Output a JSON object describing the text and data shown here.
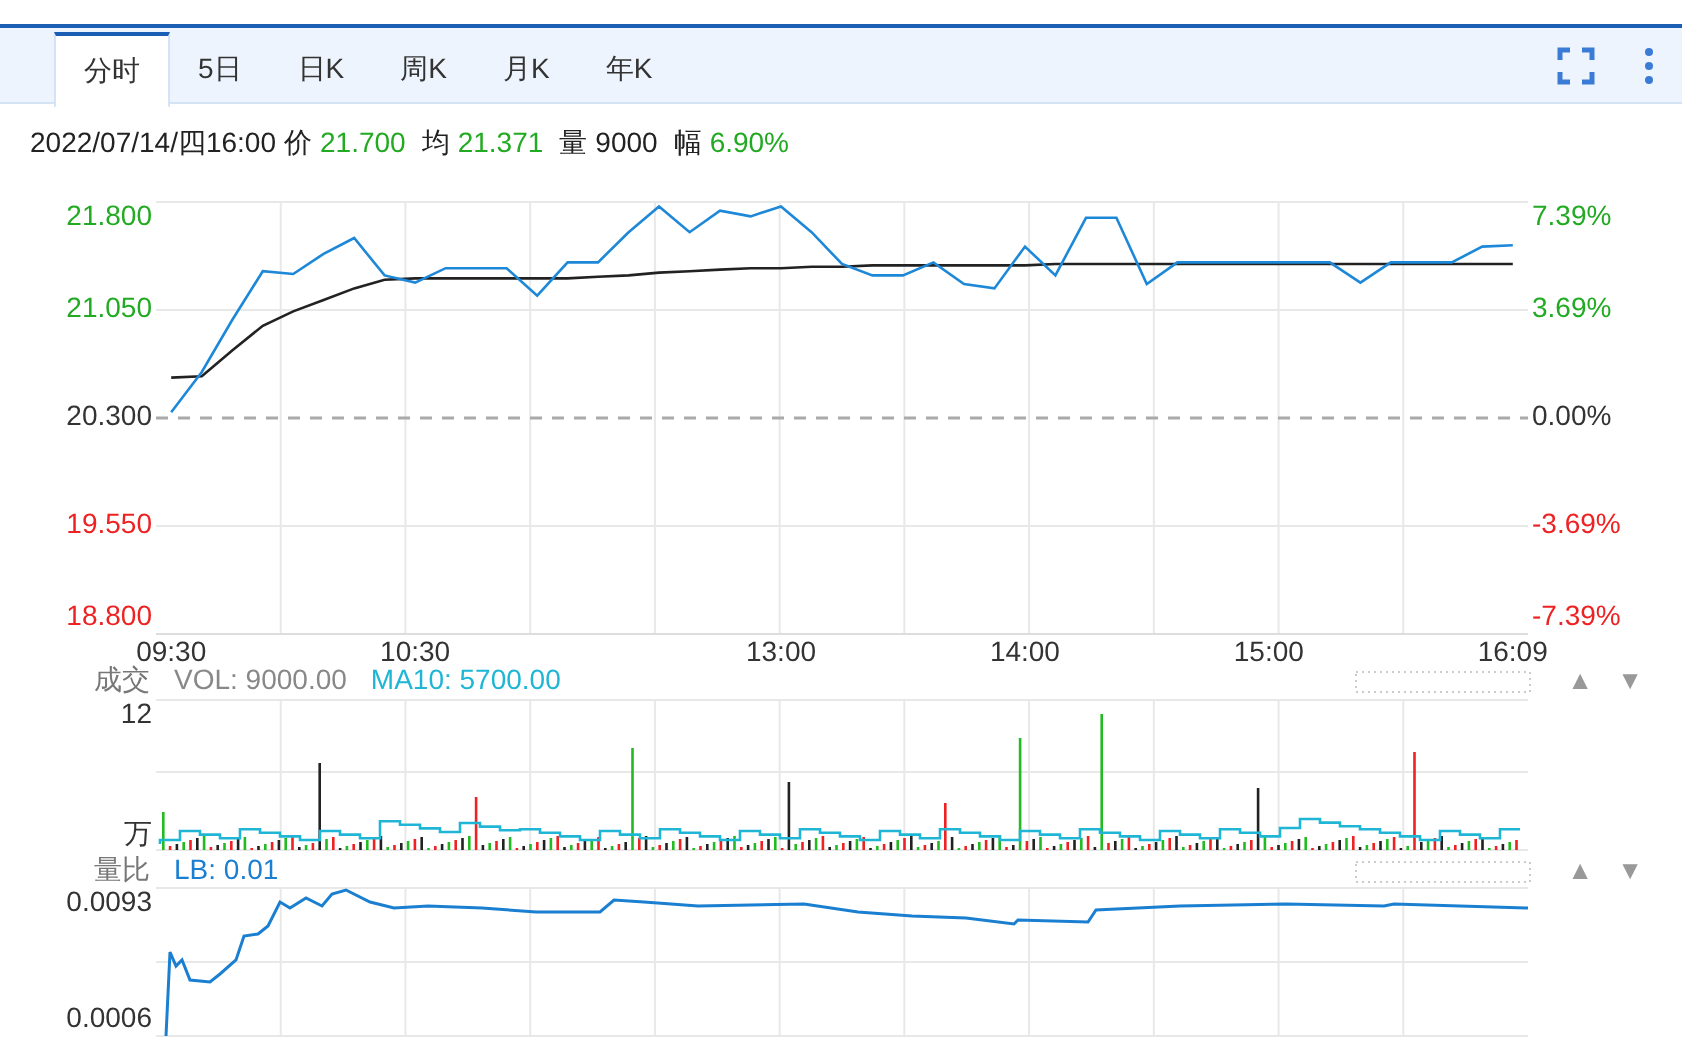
{
  "tabs": [
    {
      "label": "分时",
      "selected": true
    },
    {
      "label": "5日",
      "selected": false
    },
    {
      "label": "日K",
      "selected": false
    },
    {
      "label": "周K",
      "selected": false
    },
    {
      "label": "月K",
      "selected": false
    },
    {
      "label": "年K",
      "selected": false
    }
  ],
  "quote": {
    "datetime": "2022/07/14/四16:00",
    "fields": [
      {
        "label": "价",
        "value": "21.700",
        "color": "#22aa22"
      },
      {
        "label": "均",
        "value": "21.371",
        "color": "#22aa22"
      },
      {
        "label": "量",
        "value": "9000",
        "color": "#222222"
      },
      {
        "label": "幅",
        "value": "6.90%",
        "color": "#22aa22"
      }
    ]
  },
  "price_chart": {
    "chart_data": {
      "type": "line",
      "categories": [
        "09:30",
        null,
        null,
        null,
        null,
        null,
        null,
        null,
        "10:30",
        null,
        null,
        null,
        null,
        null,
        null,
        null,
        null,
        null,
        null,
        null,
        "13:00",
        null,
        null,
        null,
        null,
        null,
        null,
        null,
        "14:00",
        null,
        null,
        null,
        null,
        null,
        null,
        null,
        "15:00",
        null,
        null,
        null,
        null,
        null,
        null,
        null,
        "16:09"
      ],
      "series": [
        {
          "color": "#1e88d8",
          "values": [
            20.34,
            20.62,
            20.98,
            21.32,
            21.3,
            21.44,
            21.55,
            21.29,
            21.24,
            21.34,
            21.34,
            21.34,
            21.15,
            21.38,
            21.38,
            21.59,
            21.77,
            21.59,
            21.74,
            21.7,
            21.77,
            21.59,
            21.37,
            21.29,
            21.29,
            21.38,
            21.23,
            21.2,
            21.49,
            21.29,
            21.69,
            21.69,
            21.23,
            21.38,
            21.38,
            21.38,
            21.38,
            21.38,
            21.38,
            21.24,
            21.38,
            21.38,
            21.38,
            21.49,
            21.5
          ]
        },
        {
          "color": "#222222",
          "values": [
            20.58,
            20.59,
            20.77,
            20.94,
            21.04,
            21.12,
            21.2,
            21.26,
            21.27,
            21.27,
            21.27,
            21.27,
            21.27,
            21.27,
            21.28,
            21.29,
            21.31,
            21.32,
            21.33,
            21.34,
            21.34,
            21.35,
            21.35,
            21.36,
            21.36,
            21.36,
            21.36,
            21.36,
            21.36,
            21.37,
            21.37,
            21.37,
            21.37,
            21.37,
            21.37,
            21.37,
            21.37,
            21.37,
            21.37,
            21.37,
            21.37,
            21.37,
            21.37,
            21.37,
            21.37
          ]
        }
      ],
      "ylim": [
        18.8,
        21.8
      ],
      "grid": true,
      "yticks": [
        {
          "value": 21.8,
          "label": "21.800"
        },
        {
          "value": 21.05,
          "label": "21.050"
        },
        {
          "value": 20.3,
          "label": "20.300"
        },
        {
          "value": 19.55,
          "label": "19.550"
        },
        {
          "value": 18.8,
          "label": "18.800"
        }
      ],
      "ref_lines": [
        {
          "axis": "y",
          "value": 20.3
        }
      ]
    },
    "scale": [
      {
        "percent": "7.39%",
        "color": "#22aa22"
      },
      {
        "percent": "3.69%",
        "color": "#22aa22"
      },
      {
        "percent": "0.00%",
        "color": "#333333"
      },
      {
        "percent": "-3.69%",
        "color": "#ee2222"
      },
      {
        "percent": "-7.39%",
        "color": "#ee2222"
      }
    ]
  },
  "volume_panel": {
    "title": "成交",
    "vol": "VOL: 9000.00",
    "ma": "MA10: 5700.00",
    "y_labels": [
      "12",
      "万"
    ],
    "buttons": [
      "▲",
      "▼"
    ]
  },
  "ratio_panel": {
    "title": "量比",
    "lb": "LB: 0.01",
    "buttons": [
      "▲",
      "▼"
    ],
    "y_labels": [
      "0.0093",
      "0.0006"
    ]
  }
}
